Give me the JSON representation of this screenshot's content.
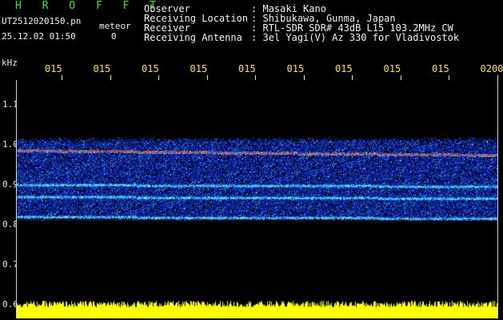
{
  "header": {
    "title": "H R O F F T",
    "file_name": "UT2512020150.pn",
    "mode": "meteor",
    "datetime": "25.12.02 01:50",
    "counter": "0"
  },
  "info": {
    "rows": [
      {
        "key": "Observer",
        "sep": ":",
        "value": "Masaki Kano"
      },
      {
        "key": "Receiving Location",
        "sep": ":",
        "value": "Shibukawa, Gunma, Japan"
      },
      {
        "key": "Receiver",
        "sep": ":",
        "value": "RTL-SDR SDR# 43dB L15 103.2MHz CW"
      },
      {
        "key": "Receiving Antenna",
        "sep": ":",
        "value": "3el Yagi(V) Az 330 for Vladivostok"
      }
    ]
  },
  "axes": {
    "y_unit": "kHz",
    "y_ticks": [
      "1.1",
      "1.0",
      "0.9",
      "0.8",
      "0.7",
      "0.6"
    ],
    "y_values": [
      1.1,
      1.0,
      0.9,
      0.8,
      0.7,
      0.6
    ],
    "x_ticks": [
      "015",
      "015",
      "015",
      "015",
      "015",
      "015",
      "015",
      "015",
      "015",
      "0200"
    ]
  },
  "spectrogram": {
    "band_khz": [
      0.81,
      1.02
    ],
    "strong_lines_khz": [
      0.986,
      0.9,
      0.87,
      0.82
    ],
    "colors": {
      "background": "#000000",
      "noise_low": "#0a1ea0",
      "noise_mid": "#1e6ee0",
      "signal": "#40e8ff",
      "peak": "#ff2a2a",
      "level": "#ffff00"
    },
    "level_strip": "bottom"
  }
}
